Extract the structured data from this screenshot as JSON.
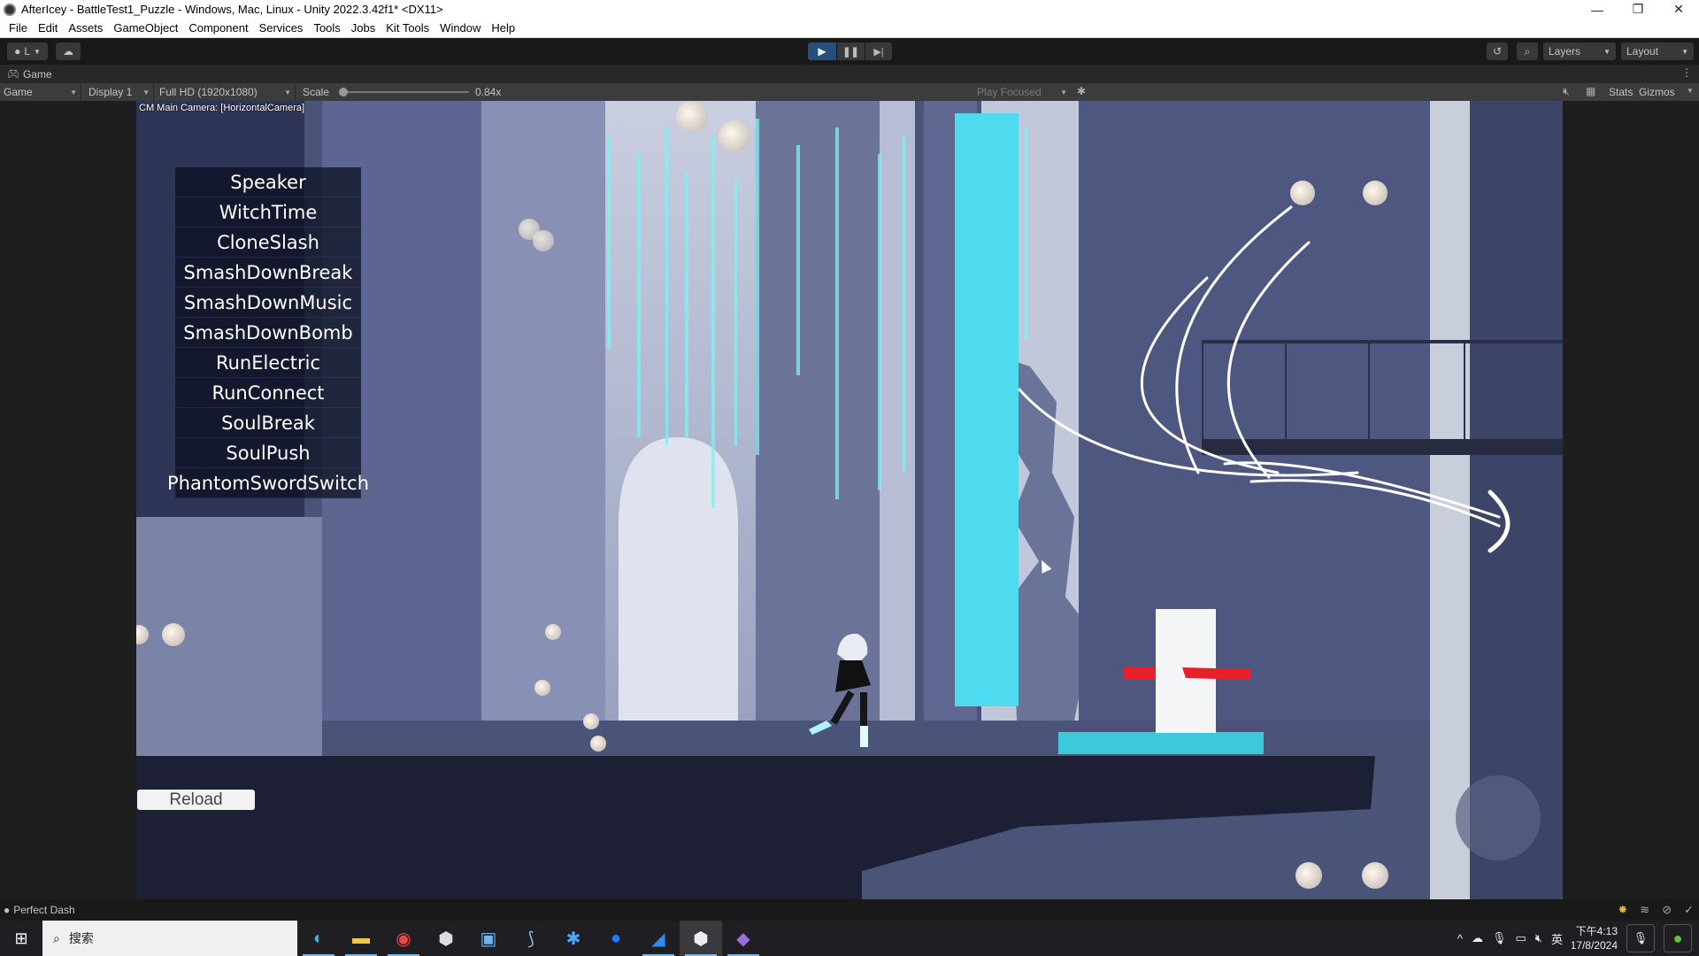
{
  "window": {
    "title": "AfterIcey - BattleTest1_Puzzle - Windows, Mac, Linux - Unity 2022.3.42f1* <DX11>",
    "minimize": "—",
    "restore": "❐",
    "close": "✕"
  },
  "menu": [
    "File",
    "Edit",
    "Assets",
    "GameObject",
    "Component",
    "Services",
    "Tools",
    "Jobs",
    "Kit Tools",
    "Window",
    "Help"
  ],
  "toolbar": {
    "account_label": "L",
    "play_icon": "▶",
    "pause_icon": "❚❚",
    "step_icon": "▶|",
    "layers_label": "Layers",
    "layout_label": "Layout",
    "play_active": true
  },
  "game_tab": {
    "label": "Game",
    "view_select": "Game",
    "display_select": "Display 1",
    "resolution_select": "Full HD (1920x1080)",
    "scale_label": "Scale",
    "scale_value": "0.84x",
    "scale_fraction": 0.0,
    "play_focused": "Play Focused",
    "stats_label": "Stats",
    "gizmos_label": "Gizmos"
  },
  "game_view": {
    "camera_label": "CM Main Camera: [HorizontalCamera]",
    "skill_buttons": [
      "Speaker",
      "WitchTime",
      "CloneSlash",
      "SmashDownBreak",
      "SmashDownMusic",
      "SmashDownBomb",
      "RunElectric",
      "RunConnect",
      "SoulBreak",
      "SoulPush",
      "PhantomSwordSwitch"
    ],
    "reload_label": "Reload",
    "colors": {
      "cyan_block": "#4fdbef",
      "red_laser": "#e8202a",
      "white_block": "#f4f5f7",
      "bg_dark": "#4a5378",
      "bg_light": "#c6ccd8"
    }
  },
  "statusbar": {
    "message": "Perfect Dash"
  },
  "taskbar": {
    "search_placeholder": "搜索",
    "apps": [
      "edge",
      "file-explorer",
      "chrome",
      "unity-hub",
      "remote-desktop",
      "mysql-workbench",
      "app-star",
      "maps-pin",
      "app-wave",
      "unity-editor",
      "visual-studio"
    ],
    "ime": "英",
    "time": "下午4:13",
    "date": "17/8/2024"
  }
}
